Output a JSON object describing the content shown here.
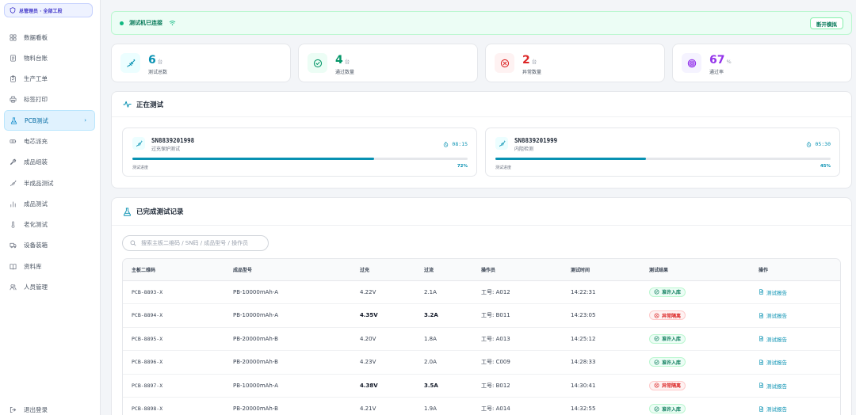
{
  "sidebar": {
    "role_badge": "总管理员 · 全部工段",
    "items": [
      {
        "label": "数据看板",
        "icon": "dashboard-icon"
      },
      {
        "label": "物料台账",
        "icon": "ledger-icon"
      },
      {
        "label": "生产工单",
        "icon": "clipboard-icon"
      },
      {
        "label": "标签打印",
        "icon": "printer-icon"
      },
      {
        "label": "PCB测试",
        "icon": "flask-icon",
        "active": true
      },
      {
        "label": "电芯派充",
        "icon": "battery-icon"
      },
      {
        "label": "成品组装",
        "icon": "wrench-icon"
      },
      {
        "label": "半成品测试",
        "icon": "probe-icon"
      },
      {
        "label": "成品测试",
        "icon": "bar-chart-icon"
      },
      {
        "label": "老化测试",
        "icon": "thermometer-icon"
      },
      {
        "label": "设备装箱",
        "icon": "truck-icon"
      },
      {
        "label": "资料库",
        "icon": "book-icon"
      },
      {
        "label": "人员管理",
        "icon": "users-icon"
      }
    ],
    "logout_label": "退出登录"
  },
  "status": {
    "text": "测试机已连接",
    "button": "断开模拟"
  },
  "stats": [
    {
      "value": "6",
      "unit": "台",
      "label": "测试总数",
      "color": "#0891b2",
      "bg": "#ecfeff",
      "icon": "probe-icon"
    },
    {
      "value": "4",
      "unit": "台",
      "label": "通过数量",
      "color": "#059669",
      "bg": "#ecfdf5",
      "icon": "check-circle-icon"
    },
    {
      "value": "2",
      "unit": "台",
      "label": "异常数量",
      "color": "#dc2626",
      "bg": "#fef2f2",
      "icon": "x-circle-icon"
    },
    {
      "value": "67",
      "unit": "%",
      "label": "通过率",
      "color": "#9333ea",
      "bg": "#f5f3ff",
      "icon": "target-icon"
    }
  ],
  "testing": {
    "title": "正在测试",
    "progress_label": "测试进度",
    "cards": [
      {
        "sn": "SN8839201998",
        "step": "过充保护测试",
        "time": "08:15",
        "progress": 0.72,
        "pct": "72%"
      },
      {
        "sn": "SN8839201999",
        "step": "内阻检测",
        "time": "05:30",
        "progress": 0.45,
        "pct": "45%"
      }
    ]
  },
  "records": {
    "title": "已完成测试记录",
    "search_placeholder": "搜索主板二维码 / SN码 / 成品型号 / 操作员",
    "columns": [
      "主板二维码",
      "成品型号",
      "过充",
      "过流",
      "操作员",
      "测试时间",
      "测试结果",
      "操作"
    ],
    "report_label": "测试报告",
    "rows": [
      {
        "code": "PCB-8893-X",
        "model": "PB-10000mAh-A",
        "ovc": "4.22V",
        "ocp": "2.1A",
        "op": "工号: A012",
        "time": "14:22:31",
        "result": "准许入库",
        "ok": true
      },
      {
        "code": "PCB-8894-X",
        "model": "PB-10000mAh-A",
        "ovc": "4.35V",
        "ocp": "3.2A",
        "op": "工号: B011",
        "time": "14:23:05",
        "result": "异常隔离",
        "ok": false
      },
      {
        "code": "PCB-8895-X",
        "model": "PB-20000mAh-B",
        "ovc": "4.20V",
        "ocp": "1.8A",
        "op": "工号: A013",
        "time": "14:25:12",
        "result": "准许入库",
        "ok": true
      },
      {
        "code": "PCB-8896-X",
        "model": "PB-20000mAh-B",
        "ovc": "4.23V",
        "ocp": "2.0A",
        "op": "工号: C009",
        "time": "14:28:33",
        "result": "准许入库",
        "ok": true
      },
      {
        "code": "PCB-8897-X",
        "model": "PB-10000mAh-A",
        "ovc": "4.38V",
        "ocp": "3.5A",
        "op": "工号: B012",
        "time": "14:30:41",
        "result": "异常隔离",
        "ok": false
      },
      {
        "code": "PCB-8898-X",
        "model": "PB-20000mAh-B",
        "ovc": "4.21V",
        "ocp": "1.9A",
        "op": "工号: A014",
        "time": "14:32:55",
        "result": "准许入库",
        "ok": true
      }
    ]
  }
}
